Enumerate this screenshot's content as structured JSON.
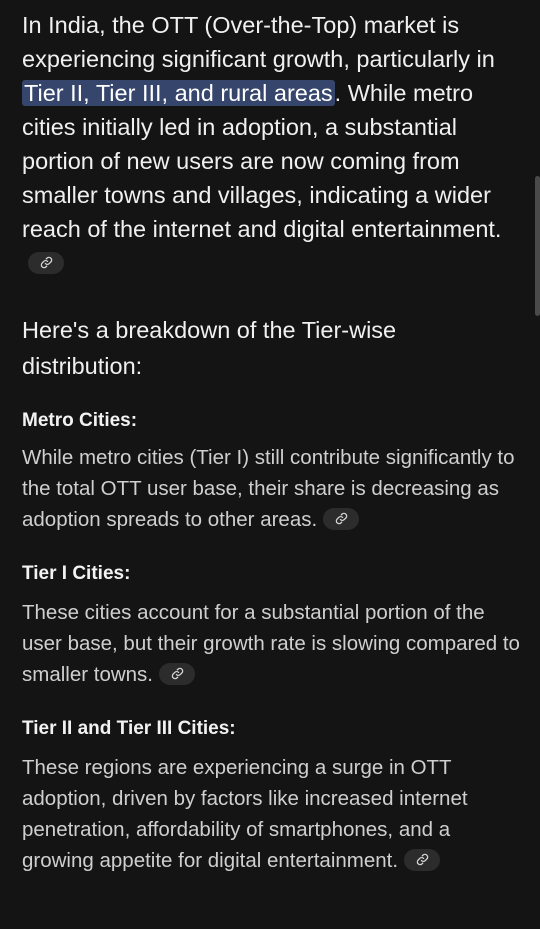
{
  "intro": {
    "before": "In India, the OTT (Over-the-Top) market is experiencing significant growth, particularly in ",
    "highlight": "Tier II, Tier III, and rural areas",
    "after": ". While metro cities initially led in adoption, a substantial portion of new users are now coming from smaller towns and villages, indicating a wider reach of the internet and digital entertainment."
  },
  "breakdown_heading": "Here's a breakdown of the Tier-wise distribution:",
  "sections": [
    {
      "heading": "Metro Cities:",
      "body": "While metro cities (Tier I) still contribute significantly to the total OTT user base, their share is decreasing as adoption spreads to other areas."
    },
    {
      "heading": "Tier I Cities:",
      "body": "These cities account for a substantial portion of the user base, but their growth rate is slowing compared to smaller towns."
    },
    {
      "heading": "Tier II and Tier III Cities:",
      "body": "These regions are experiencing a surge in OTT adoption, driven by factors like increased internet penetration, affordability of smartphones, and a growing appetite for digital entertainment."
    }
  ],
  "icons": {
    "source_link": "link-icon"
  },
  "colors": {
    "background": "#141414",
    "highlight": "#35456b",
    "chip": "#2c2c2c"
  }
}
